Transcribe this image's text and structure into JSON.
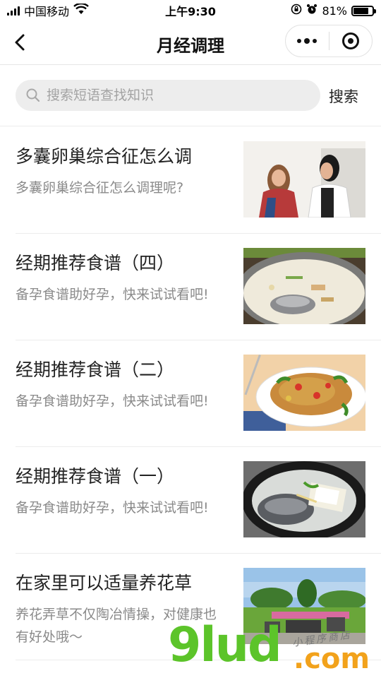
{
  "status_bar": {
    "carrier": "中国移动",
    "time": "上午9:30",
    "battery_percent": "81%",
    "battery_level": 0.81,
    "icons": [
      "signal-icon",
      "wifi-icon",
      "orientation-lock-icon",
      "alarm-icon",
      "battery-icon"
    ]
  },
  "nav": {
    "title": "月经调理",
    "back_icon": "back-chevron-icon",
    "more_icon": "more-dots-icon",
    "close_icon": "target-circle-icon"
  },
  "search": {
    "placeholder": "搜索短语查找知识",
    "value": "",
    "button_label": "搜索"
  },
  "articles": [
    {
      "title": "多囊卵巢综合征怎么调",
      "desc": "多囊卵巢综合征怎么调理呢?",
      "image": "two-women-photo"
    },
    {
      "title": "经期推荐食谱（四）",
      "desc": "备孕食谱助好孕，快来试试看吧!",
      "image": "fish-soup-photo"
    },
    {
      "title": "经期推荐食谱（二）",
      "desc": "备孕食谱助好孕，快来试试看吧!",
      "image": "stir-fry-dish-photo"
    },
    {
      "title": "经期推荐食谱（一）",
      "desc": "备孕食谱助好孕，快来试试看吧!",
      "image": "fish-tofu-pot-photo"
    },
    {
      "title": "在家里可以适量养花草",
      "desc": "养花弄草不仅陶冶情操，对健康也有好处哦～",
      "image": "garden-photo"
    }
  ],
  "watermark": {
    "text": "9lud",
    "suffix": ".com",
    "signature": "小程序商店"
  },
  "colors": {
    "watermark_green": "#5cc42a",
    "watermark_orange": "#f2a21b",
    "search_bg": "#ededed",
    "desc_gray": "#8a8a8a"
  }
}
